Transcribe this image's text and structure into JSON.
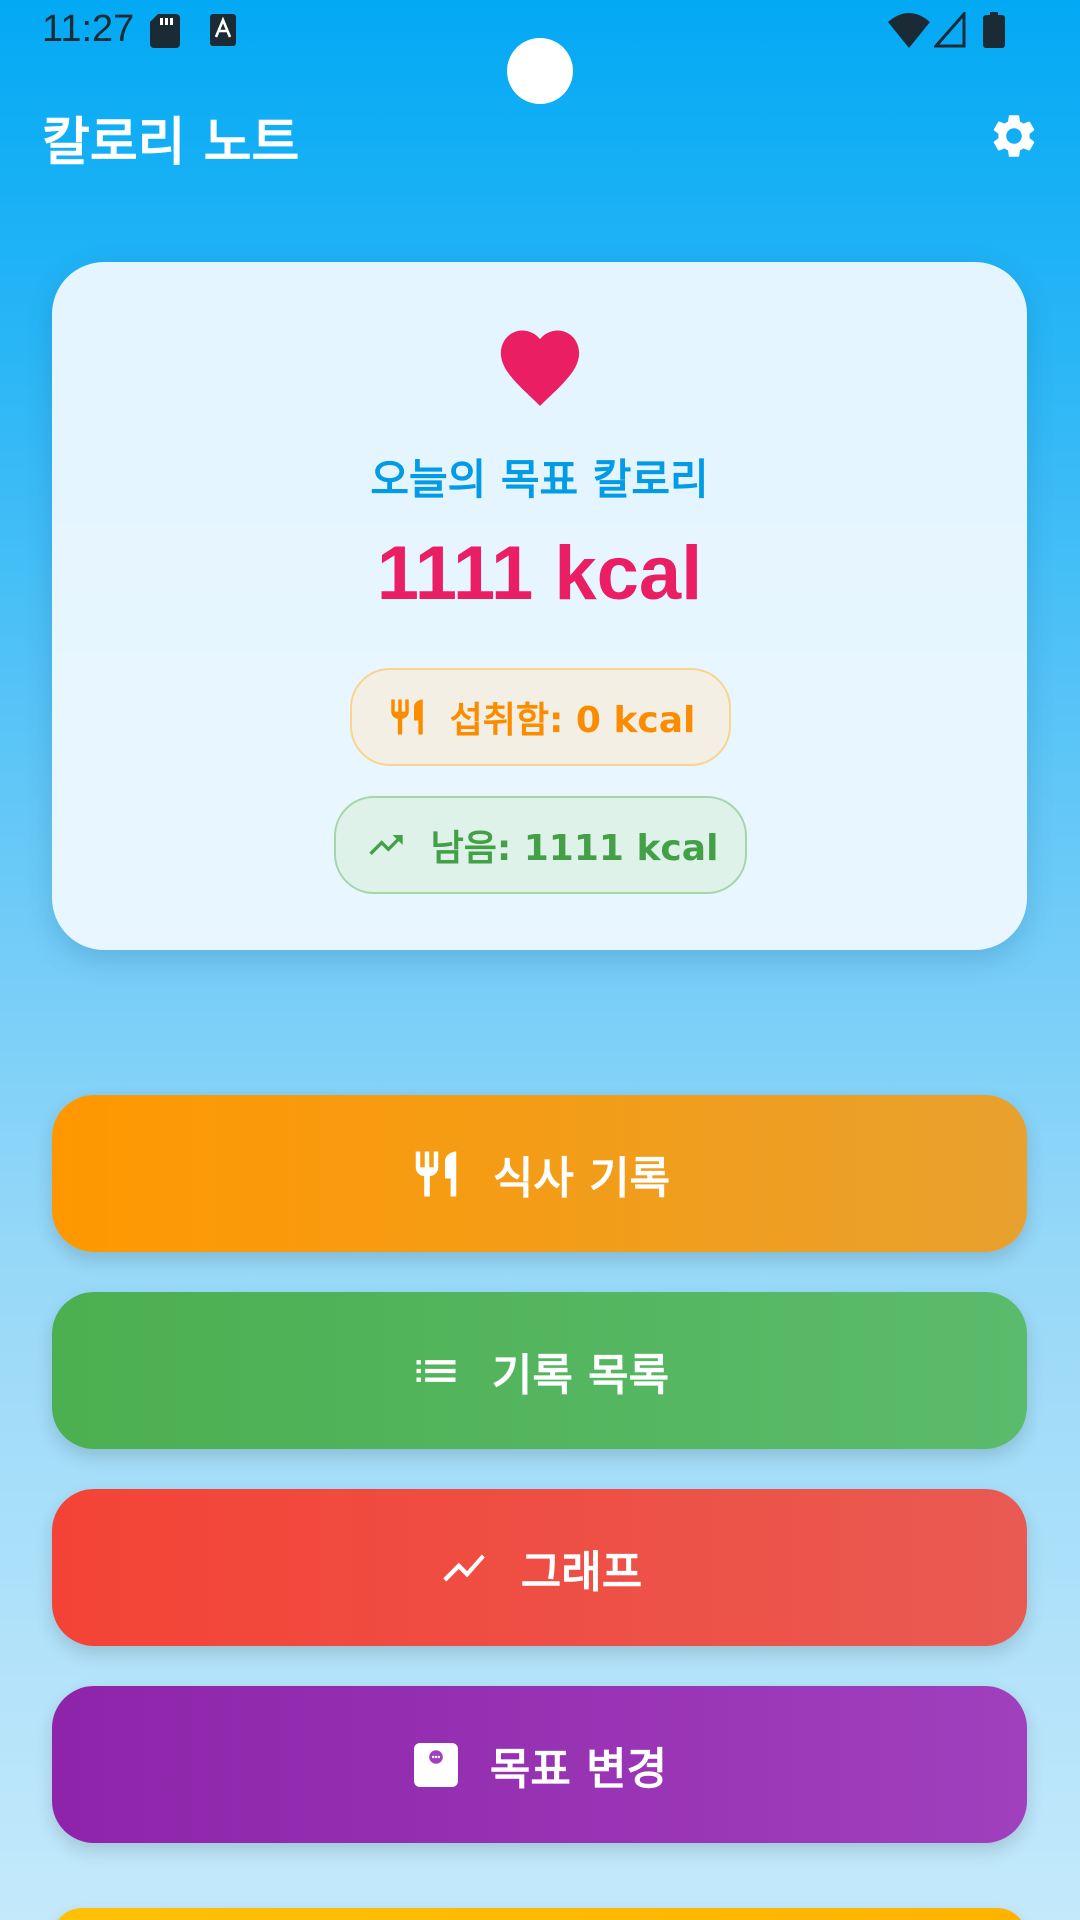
{
  "status_bar": {
    "time": "11:27",
    "icons": [
      "sd-card-icon",
      "keyboard-a-icon",
      "wifi-icon",
      "signal-icon",
      "battery-icon"
    ]
  },
  "app_bar": {
    "title": "칼로리 노트",
    "settings_icon": "gear-icon"
  },
  "summary": {
    "icon": "heart-icon",
    "label": "오늘의 목표 칼로리",
    "goal_value": "1111 kcal",
    "eaten_label": "섭취함: 0 kcal",
    "eaten_icon": "fork-knife-icon",
    "remaining_label": "남음: 1111 kcal",
    "remaining_icon": "trending-up-icon"
  },
  "actions": [
    {
      "label": "식사 기록",
      "icon": "fork-knife-icon",
      "color": "#FF9800"
    },
    {
      "label": "기록 목록",
      "icon": "list-icon",
      "color": "#4CAF50"
    },
    {
      "label": "그래프",
      "icon": "trending-up-icon",
      "color": "#F44336"
    },
    {
      "label": "목표 변경",
      "icon": "scale-icon",
      "color": "#8E24AA"
    }
  ],
  "colors": {
    "accent": "#03A9F4",
    "goal_value": "#E91E63",
    "eaten": "#FB8C00",
    "remaining": "#43A047"
  }
}
